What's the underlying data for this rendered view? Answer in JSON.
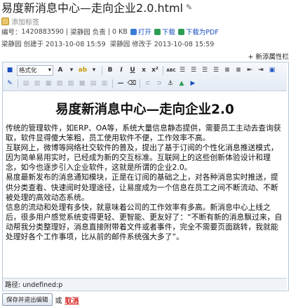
{
  "doc": {
    "title": "易度新消息中心—走向企业2.0.html",
    "add_tag": "添加标签",
    "meta": {
      "number_label": "编号：",
      "number": "1420883590",
      "owner": "梁静园",
      "owner_role": "负责",
      "size": "0 KB",
      "open": "打开",
      "download": "下载",
      "download_pdf": "下载为PDF",
      "created": "梁静园 创建于 2013-10-08 15:59",
      "modified": "梁静园 修改于 2013-10-08 15:59"
    },
    "add_property": "+ 新添属性栏"
  },
  "toolbar": {
    "format_select": "格式化",
    "bold": "B",
    "italic": "I",
    "underline": "U",
    "strike": "x",
    "superscript": "x²",
    "clear_format": "ABC",
    "font_color": "A",
    "highlight": "ab"
  },
  "content": {
    "heading_cn": "易度新消息中心—走向企业",
    "heading_num": "2.0",
    "paragraphs": [
      "传统的管理软件，如ERP、OA等，系统大量信息静态提供，需要员工主动去查询获取，软件显得傻大笨粗，员工使用软件不便，工作效率不高。",
      "互联网上，微博等网络社交软件的普及，提出了基于订阅的个性化消息推送模式，因为简单易用实时，已经成为新的交互标准。互联网上的这些创新体验设计和理念，如今也逐步引入企业软件，这就是所谓的企业2.0。",
      "易度最新发布的消息通知模块，正是在订阅的基础之上，对各种消息实时推送，提供分类查看、快速阅时处理途径，让易度成为一个信息在员工之间不断流动、不断被处理的高效动态系统。",
      "信息的流动和处理有多快，就意味着公司的工作效率有多高。新消息中心上线之后，很多用户感觉系统变得更轻、更智能、更友好了：“不断有新的消息飘过来，自动帮我分类整理好，消息直接附带着文件或者事件，完全不需要页面跳转，我就能处理好各个工作事项，比从前的邮件系统强大多了”。"
    ]
  },
  "path": "路径: undefined:p",
  "footer": {
    "save_button": "保存并退出编辑",
    "or": "或",
    "cancel": "取消"
  },
  "colors": {
    "accent": "#1a4fbf",
    "cancel": "#d21b1b",
    "toolbar_border": "#b7c7dd"
  }
}
